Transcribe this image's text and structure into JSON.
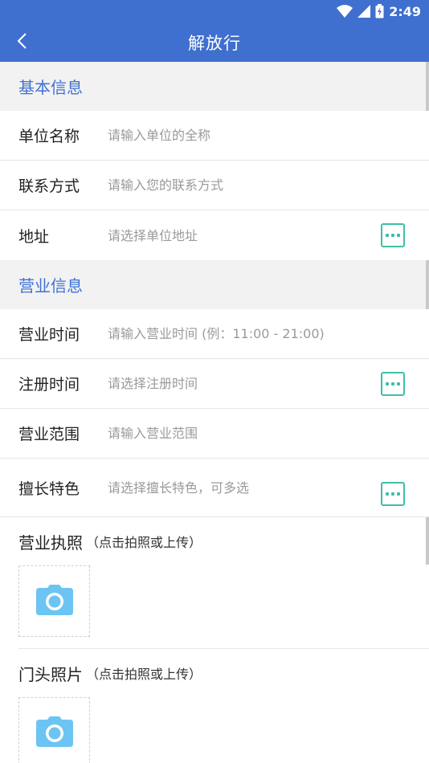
{
  "status_bar": {
    "time": "2:49"
  },
  "app_bar": {
    "title": "解放行"
  },
  "sections": {
    "basic": "基本信息",
    "business": "营业信息"
  },
  "fields": {
    "unit_name": {
      "label": "单位名称",
      "placeholder": "请输入单位的全称",
      "value": ""
    },
    "contact": {
      "label": "联系方式",
      "placeholder": "请输入您的联系方式",
      "value": ""
    },
    "address": {
      "label": "地址",
      "placeholder": "请选择单位地址",
      "value": ""
    },
    "business_hours": {
      "label": "营业时间",
      "placeholder": "请输入营业时间 (例：11:00 - 21:00)",
      "value": ""
    },
    "register_time": {
      "label": "注册时间",
      "placeholder": "请选择注册时间",
      "value": ""
    },
    "business_scope": {
      "label": "营业范围",
      "placeholder": "请输入营业范围",
      "value": ""
    },
    "specialty": {
      "label": "擅长特色",
      "placeholder": "请选择擅长特色，可多选",
      "value": ""
    }
  },
  "uploads": {
    "license": {
      "title": "营业执照",
      "hint": "（点击拍照或上传）"
    },
    "storefront": {
      "title": "门头照片",
      "hint": "（点击拍照或上传）"
    }
  },
  "colors": {
    "primary": "#3f6fcf",
    "section_text": "#3f72d4",
    "more_button": "#3fbfa8",
    "camera": "#6cc4f2"
  },
  "icons": {
    "back": "chevron-left-icon",
    "more": "more-dots-icon",
    "camera": "camera-icon"
  }
}
